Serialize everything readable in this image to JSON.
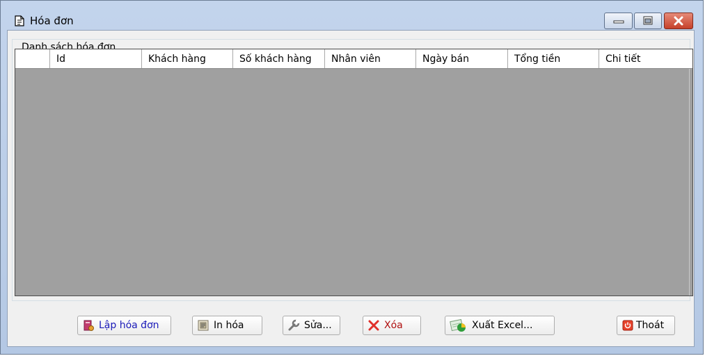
{
  "window": {
    "title": "Hóa đơn",
    "controls": {
      "minimize": "minimize-icon",
      "maximize": "maximize-icon",
      "close": "close-icon"
    }
  },
  "group": {
    "label": "Danh sách hóa đơn"
  },
  "grid": {
    "columns": [
      "",
      "Id",
      "Khách hàng",
      "Số khách hàng",
      "Nhân viên",
      "Ngày bán",
      "Tổng tiền",
      "Chi tiết"
    ],
    "rows": []
  },
  "buttons": {
    "create": "Lập hóa đơn",
    "print": "In hóa",
    "edit": "Sửa...",
    "delete": "Xóa",
    "export": "Xuất Excel...",
    "exit": "Thoát"
  },
  "colors": {
    "grid_background": "#a0a0a0",
    "title_gradient": "#c3d4ec",
    "close_button": "#c6402a"
  }
}
